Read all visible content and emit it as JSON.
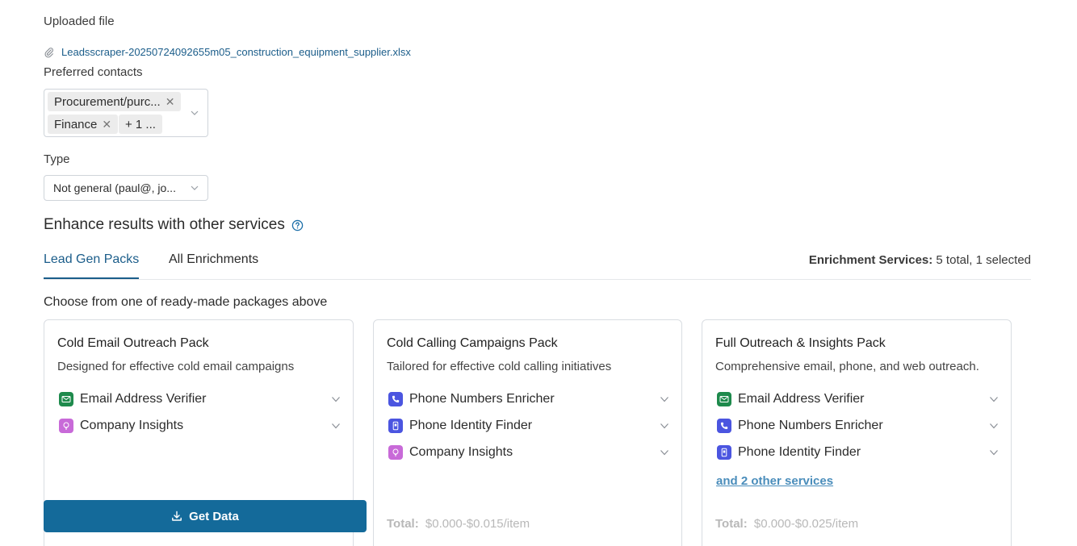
{
  "uploaded_file": {
    "label": "Uploaded file",
    "file_name": "Leadsscraper-20250724092655m05_construction_equipment_supplier.xlsx"
  },
  "preferred_contacts": {
    "label": "Preferred contacts",
    "chips": [
      "Procurement/purc...",
      "Finance"
    ],
    "more": "+ 1 ..."
  },
  "type": {
    "label": "Type",
    "selected": "Not general (paul@, jo..."
  },
  "enhance": {
    "title": "Enhance results with other services"
  },
  "tabs": [
    {
      "label": "Lead Gen Packs",
      "active": true
    },
    {
      "label": "All Enrichments",
      "active": false
    }
  ],
  "summary": {
    "label": "Enrichment Services:",
    "value": "5 total, 1 selected"
  },
  "choose_text": "Choose from one of ready-made packages above",
  "cards": [
    {
      "title": "Cold Email Outreach Pack",
      "description": "Designed for effective cold email campaigns",
      "services": [
        {
          "name": "Email Address Verifier",
          "icon": "email-verifier-icon",
          "color": "#1e8a4c"
        },
        {
          "name": "Company Insights",
          "icon": "lightbulb-icon",
          "color": "#c86ad8"
        }
      ]
    },
    {
      "title": "Cold Calling Campaigns Pack",
      "description": "Tailored for effective cold calling initiatives",
      "services": [
        {
          "name": "Phone Numbers Enricher",
          "icon": "phone-icon",
          "color": "#4b55e0"
        },
        {
          "name": "Phone Identity Finder",
          "icon": "mobile-icon",
          "color": "#4b55e0"
        },
        {
          "name": "Company Insights",
          "icon": "lightbulb-icon",
          "color": "#c86ad8"
        }
      ],
      "total_label": "Total:",
      "total_value": "$0.000-$0.015/item"
    },
    {
      "title": "Full Outreach & Insights Pack",
      "description": "Comprehensive email, phone, and web outreach.",
      "services": [
        {
          "name": "Email Address Verifier",
          "icon": "email-verifier-icon",
          "color": "#1e8a4c"
        },
        {
          "name": "Phone Numbers Enricher",
          "icon": "phone-icon",
          "color": "#4b55e0"
        },
        {
          "name": "Phone Identity Finder",
          "icon": "mobile-icon",
          "color": "#4b55e0"
        }
      ],
      "more_link": "and 2 other services",
      "total_label": "Total:",
      "total_value": "$0.000-$0.025/item"
    }
  ],
  "get_data": {
    "label": "Get Data"
  },
  "colors": {
    "accent": "#146a9a",
    "link": "#1b5d8a"
  }
}
